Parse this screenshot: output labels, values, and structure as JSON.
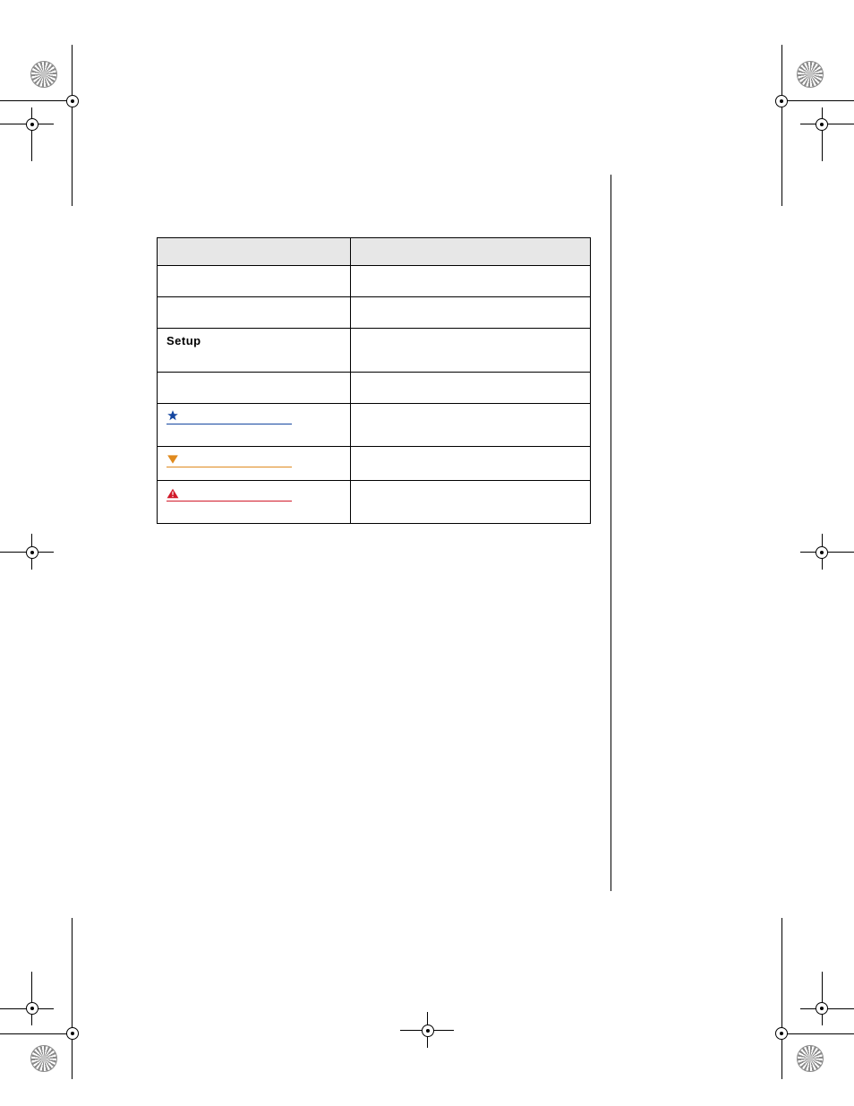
{
  "table": {
    "headers": [
      "",
      ""
    ],
    "rows": [
      {
        "left": "",
        "right": ""
      },
      {
        "left": "",
        "right": ""
      },
      {
        "left_bold": "Setup",
        "right": ""
      },
      {
        "left": "",
        "right": ""
      },
      {
        "link_class": "blue",
        "icon": "star",
        "left": "",
        "right": ""
      },
      {
        "link_class": "orange",
        "icon": "triangle",
        "left": "",
        "right": ""
      },
      {
        "link_class": "red",
        "icon": "warning",
        "left": "",
        "right": ""
      }
    ]
  }
}
